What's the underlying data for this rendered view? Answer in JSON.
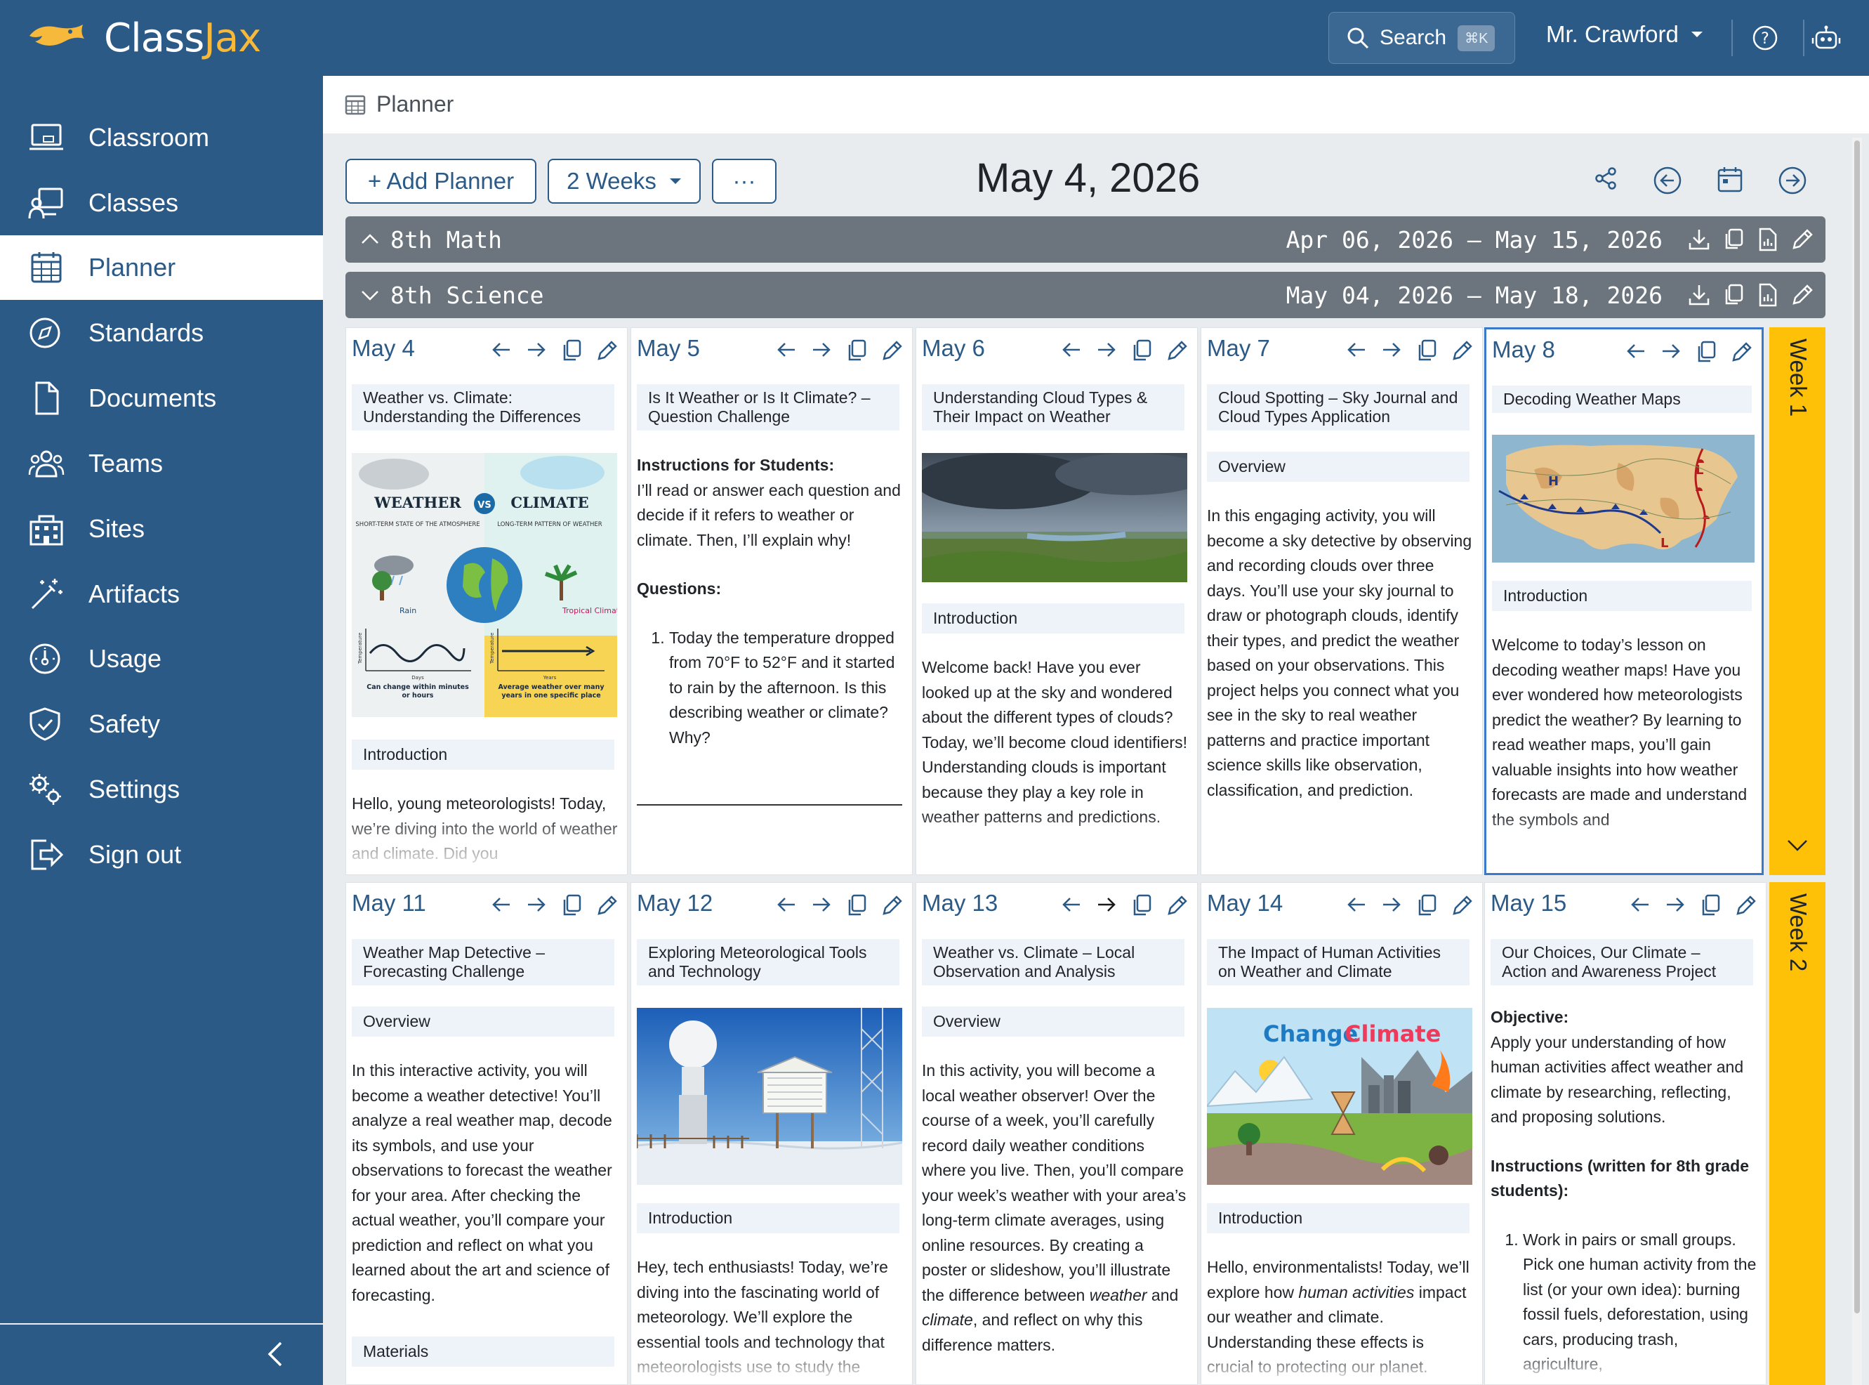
{
  "app": {
    "brand_class": "Class",
    "brand_jax": "Jax"
  },
  "topbar": {
    "search_label": "Search",
    "search_shortcut": "⌘K",
    "user_name": "Mr. Crawford"
  },
  "sidebar": {
    "items": [
      {
        "label": "Classroom",
        "icon": "laptop-icon"
      },
      {
        "label": "Classes",
        "icon": "teacher-board-icon"
      },
      {
        "label": "Planner",
        "icon": "calendar-icon"
      },
      {
        "label": "Standards",
        "icon": "compass-icon"
      },
      {
        "label": "Documents",
        "icon": "document-icon"
      },
      {
        "label": "Teams",
        "icon": "users-icon"
      },
      {
        "label": "Sites",
        "icon": "building-icon"
      },
      {
        "label": "Artifacts",
        "icon": "magic-wand-icon"
      },
      {
        "label": "Usage",
        "icon": "gauge-icon"
      },
      {
        "label": "Safety",
        "icon": "shield-check-icon"
      },
      {
        "label": "Settings",
        "icon": "gears-icon"
      },
      {
        "label": "Sign out",
        "icon": "sign-out-icon"
      }
    ],
    "active": "Planner"
  },
  "breadcrumb": {
    "label": "Planner"
  },
  "toolbar": {
    "add_planner": "+ Add Planner",
    "range": "2 Weeks",
    "more": "···",
    "current_date": "May 4, 2026"
  },
  "planners": [
    {
      "name": "8th Math",
      "range": "Apr 06, 2026 – May 15, 2026",
      "expanded": false
    },
    {
      "name": "8th Science",
      "range": "May 04, 2026 – May 18, 2026",
      "expanded": true
    }
  ],
  "weeks": [
    "Week 1",
    "Week 2"
  ],
  "days": {
    "may4": {
      "date": "May 4",
      "title": "Weather vs. Climate: Understanding the Differences",
      "section": "Introduction",
      "text": "Hello, young meteorologists! Today, we’re diving into the world of weather and climate. Did you",
      "image": {
        "left_title": "WEATHER",
        "left_sub": "SHORT-TERM STATE OF THE ATMOSPHERE",
        "vs": "VS",
        "right_title": "CLIMATE",
        "right_sub": "LONG-TERM PATTERN OF WEATHER",
        "rain": "Rain",
        "tropical": "Tropical Climate",
        "temperature": "Temperature",
        "days": "Days",
        "years": "Years",
        "left_foot": "Can change within minutes or hours",
        "right_foot": "Average weather over many years in one specific place"
      }
    },
    "may5": {
      "date": "May 5",
      "title": "Is It Weather or Is It Climate? – Question Challenge",
      "instr_head": "Instructions for Students:",
      "instr": "I’ll read or answer each question and decide if it refers to weather or climate. Then, I’ll explain why!",
      "q_head": "Questions:",
      "q1": "Today the temperature dropped from 70°F to 52°F and it started to rain by the afternoon. Is this describing weather or climate? Why?"
    },
    "may6": {
      "date": "May 6",
      "title": "Understanding Cloud Types & Their Impact on Weather",
      "section": "Introduction",
      "text": "Welcome back! Have you ever looked up at the sky and wondered about the different types of clouds? Today, we’ll become cloud identifiers! Understanding clouds is important because they play a key role in weather patterns and predictions."
    },
    "may7": {
      "date": "May 7",
      "title": "Cloud Spotting – Sky Journal and Cloud Types Application",
      "section": "Overview",
      "text": "In this engaging activity, you will become a sky detective by observing and recording clouds over three days. You’ll use your sky journal to draw or photograph clouds, identify their types, and predict the weather based on your observations. This project helps you connect what you see in the sky to real weather patterns and practice important science skills like observation, classification, and prediction."
    },
    "may8": {
      "date": "May 8",
      "title": "Decoding Weather Maps",
      "section": "Introduction",
      "text": "Welcome to today’s lesson on decoding weather maps! Have you ever wondered how meteorologists predict the weather? By learning to read weather maps, you’ll gain valuable insights into how weather forecasts are made and understand the symbols and",
      "map_h": "H",
      "map_l": "L"
    },
    "may11": {
      "date": "May 11",
      "title": "Weather Map Detective – Forecasting Challenge",
      "section": "Overview",
      "text": "In this interactive activity, you will become a weather detective! You’ll analyze a real weather map, decode its symbols, and use your observations to forecast the weather for your area. After checking the actual weather, you’ll compare your prediction and reflect on what you learned about the art and science of forecasting.",
      "section2": "Materials"
    },
    "may12": {
      "date": "May 12",
      "title": "Exploring Meteorological Tools and Technology",
      "section": "Introduction",
      "text": "Hey, tech enthusiasts! Today, we’re diving into the fascinating world of meteorology. We’ll explore the essential tools and technology that meteorologists use to study the"
    },
    "may13": {
      "date": "May 13",
      "title": "Weather vs. Climate – Local Observation and Analysis",
      "section": "Overview",
      "text_a": "In this activity, you will become a local weather observer! Over the course of a week, you’ll carefully record daily weather conditions where you live. Then, you’ll compare your week’s weather with your area’s long-term climate averages, using online resources. By creating a poster or slideshow, you’ll illustrate the difference between ",
      "em1": "weather",
      "text_b": " and ",
      "em2": "climate",
      "text_c": ", and reflect on why this difference matters."
    },
    "may14": {
      "date": "May 14",
      "title": "The Impact of Human Activities on Weather and Climate",
      "section": "Introduction",
      "text_a": "Hello, environmentalists! Today, we’ll explore how ",
      "em1": "human activities",
      "text_b": " impact our weather and climate. Understanding these effects is crucial to protecting our planet.",
      "image": {
        "word1": "Change",
        "word2": "Climate"
      }
    },
    "may15": {
      "date": "May 15",
      "title": "Our Choices, Our Climate – Action and Awareness Project",
      "obj_head": "Objective:",
      "obj": "Apply your understanding of how human activities affect weather and climate by researching, reflecting, and proposing solutions.",
      "instr_head": "Instructions (written for 8th grade students):",
      "step1": "Work in pairs or small groups. Pick one human activity from the list (or your own idea): burning fossil fuels, deforestation, using cars, producing trash, agriculture,"
    }
  },
  "colors": {
    "brand": "#2b5a87",
    "accent": "#f6b93b",
    "week_tab": "#ffc107",
    "planner_bar": "#6c757d"
  }
}
